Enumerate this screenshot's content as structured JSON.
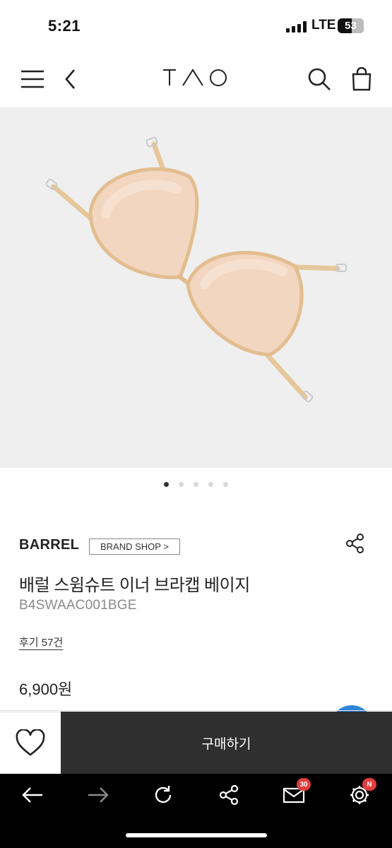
{
  "status_bar": {
    "time": "5:21",
    "network": "LTE",
    "battery": "53",
    "battery_level": 0.53
  },
  "header": {
    "menu_icon": "hamburger-icon",
    "back_icon": "chevron-left-icon",
    "logo_text": "TAO",
    "search_icon": "search-icon",
    "cart_icon": "shopping-bag-icon"
  },
  "gallery": {
    "image_count": 5,
    "active_index": 0,
    "image_alt": "beige swim bra cups"
  },
  "product": {
    "brand": "BARREL",
    "brand_shop_label": "BRAND SHOP >",
    "name": "배럴 스윔슈트 이너 브라캡 베이지",
    "code": "B4SWAAC001BGE",
    "reviews": "후기 57건",
    "price": "6,900원"
  },
  "purchase": {
    "wishlist_icon": "heart-icon",
    "buy_label": "구매하기"
  },
  "toolbar": {
    "back_icon": "arrow-left-icon",
    "forward_icon": "arrow-right-icon",
    "refresh_icon": "refresh-icon",
    "share_icon": "share-icon",
    "mail_icon": "mail-icon",
    "mail_badge": "30",
    "settings_icon": "gear-icon",
    "settings_badge": "N"
  },
  "colors": {
    "buy_button": "#2f2f2f",
    "image_bg": "#efefef",
    "badge": "#e23d3d",
    "product_cup": "#f2d6bf"
  }
}
